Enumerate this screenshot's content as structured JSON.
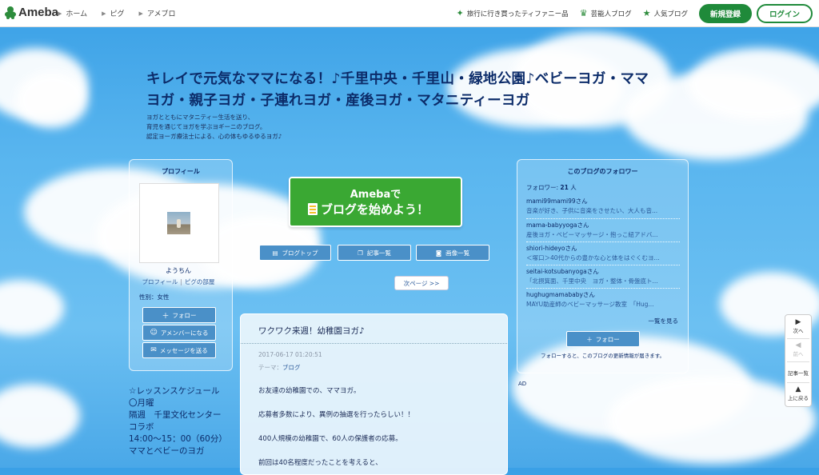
{
  "header": {
    "logo_text": "Ameba",
    "nav": [
      "ホーム",
      "ピグ",
      "アメブロ"
    ],
    "links": [
      {
        "label": "旅行に行き買ったティファニー品",
        "icon": "sparkle-icon"
      },
      {
        "label": "芸能人ブログ",
        "icon": "crown-icon"
      },
      {
        "label": "人気ブログ",
        "icon": "star-icon"
      }
    ],
    "register_label": "新規登録",
    "login_label": "ログイン"
  },
  "blog": {
    "title_line1": "キレイで元気なママになる！♪千里中央・千里山・緑地公園♪ベビーヨガ・ママ",
    "title_line2": "ヨガ・親子ヨガ・子連れヨガ・産後ヨガ・マタニティーヨガ",
    "desc_line1": "ヨガとともにマタニティー生活を送り、",
    "desc_line2": "育児を通じてヨガを学ぶヨギーニのブログ。",
    "desc_line3": "認定ヨーガ療法士による、心の体もゆるゆるヨガ♪"
  },
  "profile": {
    "heading": "プロフィール",
    "name": "ようちん",
    "link_profile": "プロフィール",
    "separator": "|",
    "link_room": "ピグの部屋",
    "gender": "性別：女性",
    "follow_label": "フォロー",
    "amember_label": "アメンバーになる",
    "message_label": "メッセージを送る"
  },
  "lesson": {
    "lines": [
      "☆レッスンスケジュール",
      "〇月曜",
      "隔週　千里文化センター",
      "コラボ",
      "14:00〜15：00（60分）",
      "ママとベビーのヨガ"
    ]
  },
  "center": {
    "start_l1": "Amebaで",
    "start_l2": "ブログを始めよう！",
    "btn_top": "ブログトップ",
    "btn_list": "記事一覧",
    "btn_images": "画像一覧",
    "next_page": "次ページ >>"
  },
  "article": {
    "title": "ワクワク来週！幼稚園ヨガ♪",
    "date": "2017-06-17 01:20:51",
    "theme_prefix": "テーマ：",
    "theme": "ブログ",
    "paragraphs": [
      "お友達の幼稚園での、ママヨガ。",
      "応募者多数により、異例の抽選を行ったらしい！！",
      "400人規模の幼稚園で、60人の保護者の応募。",
      "前回は40名程度だったことを考えると、"
    ]
  },
  "followers": {
    "heading": "このブログのフォロワー",
    "count_label": "フォロワー:",
    "count": "21",
    "count_unit": "人",
    "items": [
      {
        "name": "mami99mami99さん",
        "desc": "音楽が好き、子供に音楽をさせたい、大人も音..."
      },
      {
        "name": "mama-babyyogaさん",
        "desc": "産後ヨガ・ベビーマッサージ・抱っこ紐アドバ..."
      },
      {
        "name": "shiori-hideyoさん",
        "desc": "＜塚口＞40代からの豊かな心と体をはぐくむヨ..."
      },
      {
        "name": "seitai-kotsubanyogaさん",
        "desc": "「北摂箕面、千里中央　ヨガ・整体・骨盤底ト..."
      },
      {
        "name": "hughugmamababyさん",
        "desc": "MAYU助産師のベビーマッサージ教室　「Hug..."
      }
    ],
    "more_label": "一覧を見る",
    "follow_label": "フォロー",
    "note": "フォローすると、このブログの更新情報が届きます。"
  },
  "ad_label": "AD",
  "side_nav": {
    "next": "次へ",
    "prev": "前へ",
    "list": "記事一覧",
    "top": "上に戻る"
  }
}
